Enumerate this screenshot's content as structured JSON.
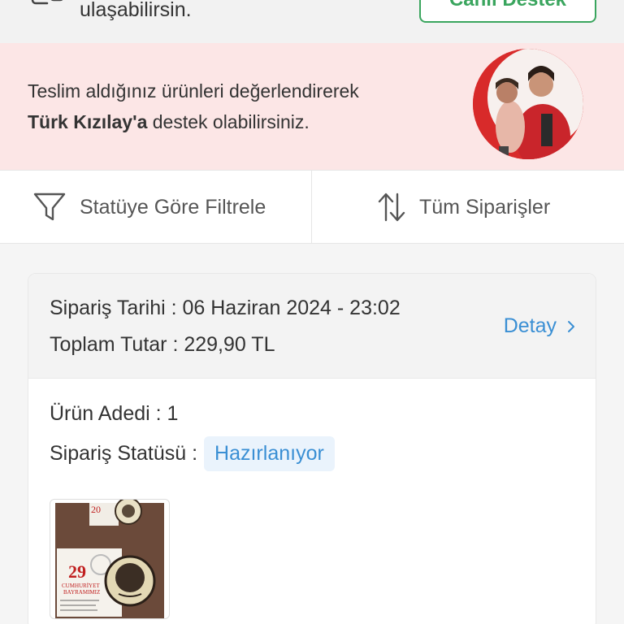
{
  "top_bar": {
    "text": "ulaşabilirsin.",
    "live_support_label": "Canlı Destek"
  },
  "banner": {
    "line1": "Teslim aldığınız ürünleri değerlendirerek",
    "line2_bold": "Türk Kızılay'a",
    "line2_rest": " destek olabilirsiniz."
  },
  "filters": {
    "status_filter_label": "Statüye Göre Filtrele",
    "sort_label": "Tüm Siparişler"
  },
  "order": {
    "date_line": "Sipariş Tarihi : 06 Haziran 2024 - 23:02",
    "total_line": "Toplam Tutar : 229,90 TL",
    "detail_label": "Detay",
    "count_line": "Ürün Adedi : 1",
    "status_label": "Sipariş Statüsü :",
    "status_value": "Hazırlanıyor"
  },
  "thumbnail_text": {
    "top_number": "20",
    "number": "29",
    "line1": "CUMHURİYET",
    "line2": "BAYRAMIMIZ"
  },
  "colors": {
    "accent_green": "#3aa55e",
    "link_blue": "#3a8fd4",
    "banner_pink": "#fce6e6",
    "red_crescent": "#d82a2a"
  }
}
